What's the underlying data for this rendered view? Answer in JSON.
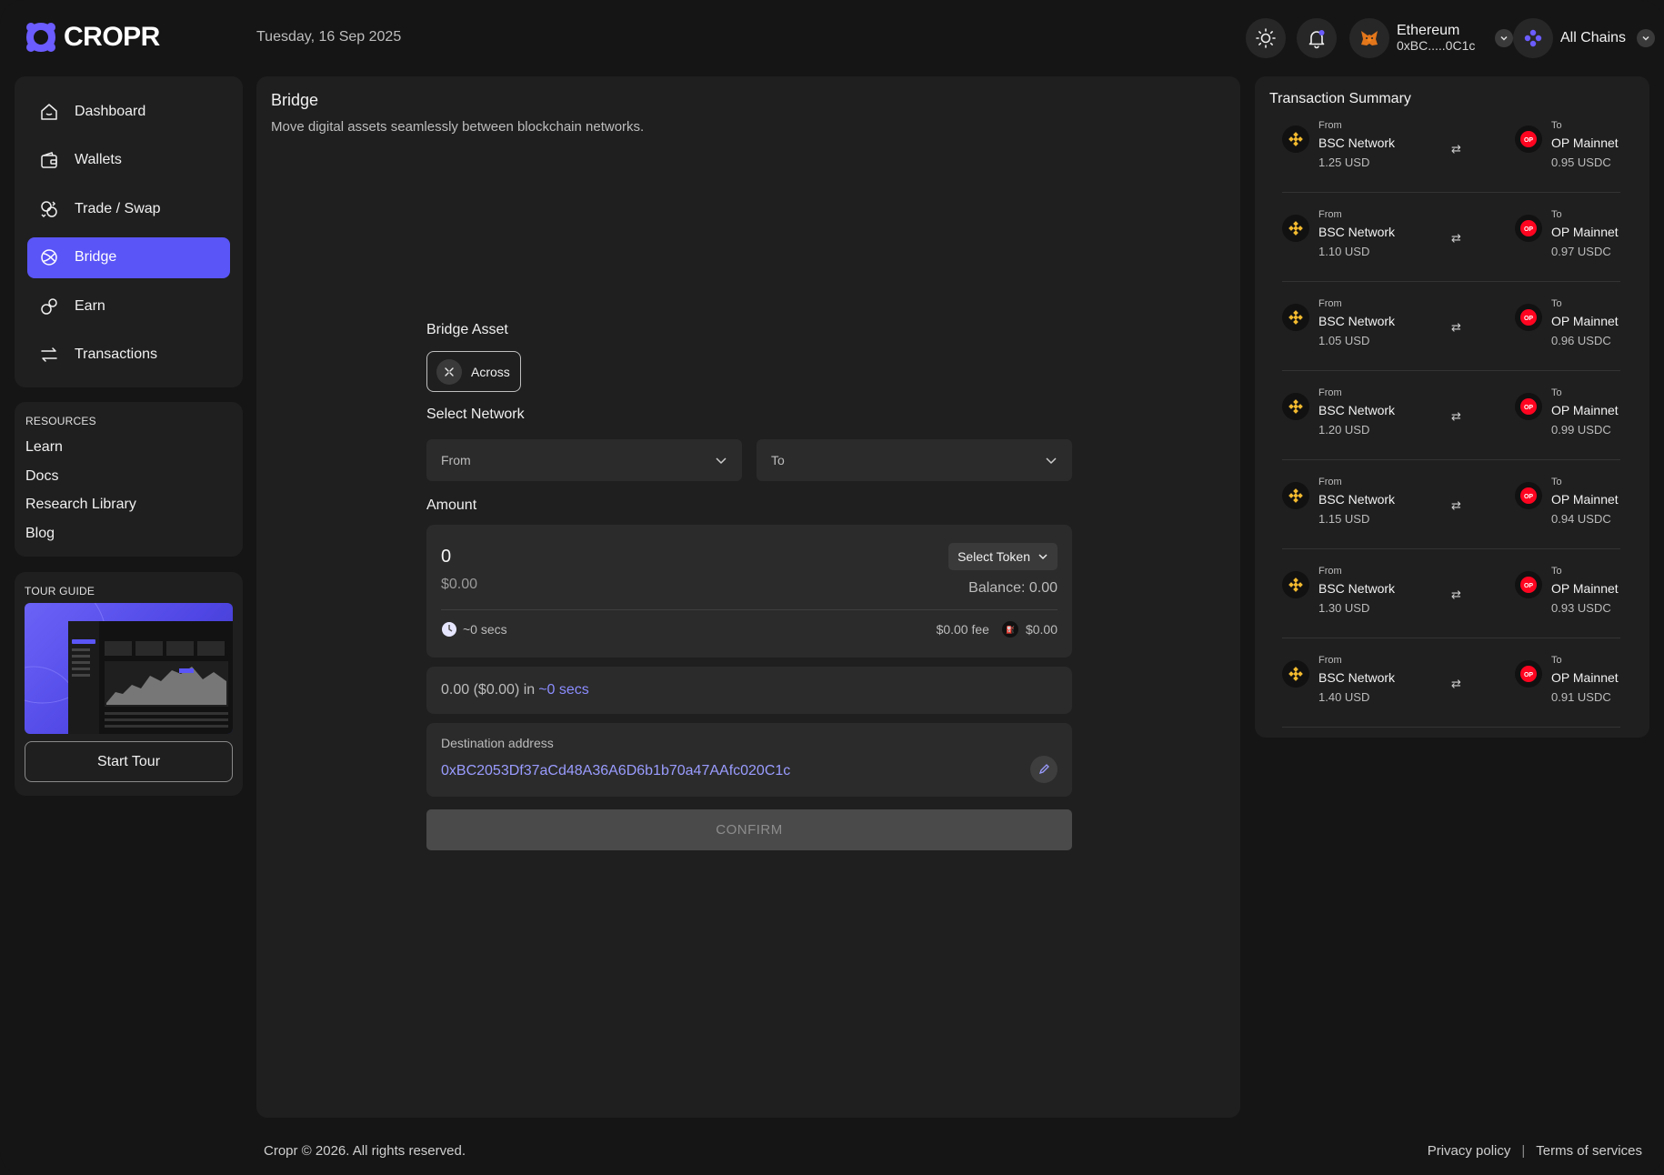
{
  "header": {
    "brand": "CROPR",
    "date": "Tuesday, 16 Sep 2025",
    "wallet": {
      "network": "Ethereum",
      "address": "0xBC.....0C1c"
    },
    "chains_label": "All Chains"
  },
  "sidebar": {
    "items": [
      {
        "label": "Dashboard",
        "icon": "home-icon"
      },
      {
        "label": "Wallets",
        "icon": "wallet-icon"
      },
      {
        "label": "Trade / Swap",
        "icon": "swap-coins-icon"
      },
      {
        "label": "Bridge",
        "icon": "bridge-icon",
        "active": true
      },
      {
        "label": "Earn",
        "icon": "earn-icon"
      },
      {
        "label": "Transactions",
        "icon": "transfer-arrows-icon"
      }
    ],
    "resources": {
      "title": "RESOURCES",
      "links": [
        "Learn",
        "Docs",
        "Research Library",
        "Blog"
      ]
    },
    "tour": {
      "title": "TOUR GUIDE",
      "button": "Start Tour"
    }
  },
  "main": {
    "title": "Bridge",
    "subtitle": "Move digital assets seamlessly between blockchain networks.",
    "form": {
      "asset_label": "Bridge Asset",
      "provider": "Across",
      "network_label": "Select Network",
      "from_placeholder": "From",
      "to_placeholder": "To",
      "amount_label": "Amount",
      "amount_value": "0",
      "amount_usd": "$0.00",
      "token_button": "Select Token",
      "balance": "Balance: 0.00",
      "time": "~0 secs",
      "fee": "$0.00 fee",
      "gas": "$0.00",
      "estimate_prefix": "0.00 ($0.00) in",
      "estimate_time": "~0 secs",
      "dest_label": "Destination address",
      "dest_address": "0xBC2053Df37aCd48A36A6D6b1b70a47AAfc020C1c",
      "confirm": "CONFIRM"
    }
  },
  "summary": {
    "title": "Transaction Summary",
    "transactions": [
      {
        "from_label": "From",
        "from_net": "BSC Network",
        "from_amt": "1.25 USD",
        "to_label": "To",
        "to_net": "OP Mainnet",
        "to_amt": "0.95 USDC"
      },
      {
        "from_label": "From",
        "from_net": "BSC Network",
        "from_amt": "1.10 USD",
        "to_label": "To",
        "to_net": "OP Mainnet",
        "to_amt": "0.97 USDC"
      },
      {
        "from_label": "From",
        "from_net": "BSC Network",
        "from_amt": "1.05 USD",
        "to_label": "To",
        "to_net": "OP Mainnet",
        "to_amt": "0.96 USDC"
      },
      {
        "from_label": "From",
        "from_net": "BSC Network",
        "from_amt": "1.20 USD",
        "to_label": "To",
        "to_net": "OP Mainnet",
        "to_amt": "0.99 USDC"
      },
      {
        "from_label": "From",
        "from_net": "BSC Network",
        "from_amt": "1.15 USD",
        "to_label": "To",
        "to_net": "OP Mainnet",
        "to_amt": "0.94 USDC"
      },
      {
        "from_label": "From",
        "from_net": "BSC Network",
        "from_amt": "1.30 USD",
        "to_label": "To",
        "to_net": "OP Mainnet",
        "to_amt": "0.93 USDC"
      },
      {
        "from_label": "From",
        "from_net": "BSC Network",
        "from_amt": "1.40 USD",
        "to_label": "To",
        "to_net": "OP Mainnet",
        "to_amt": "0.91 USDC"
      }
    ]
  },
  "footer": {
    "copyright": "Cropr © 2026. All rights reserved.",
    "privacy": "Privacy policy",
    "terms": "Terms of services"
  },
  "colors": {
    "accent": "#5a55f6",
    "background": "#151515",
    "panel": "#1f1f1f",
    "bnb": "#f3ba2f",
    "op": "#ff0420"
  }
}
